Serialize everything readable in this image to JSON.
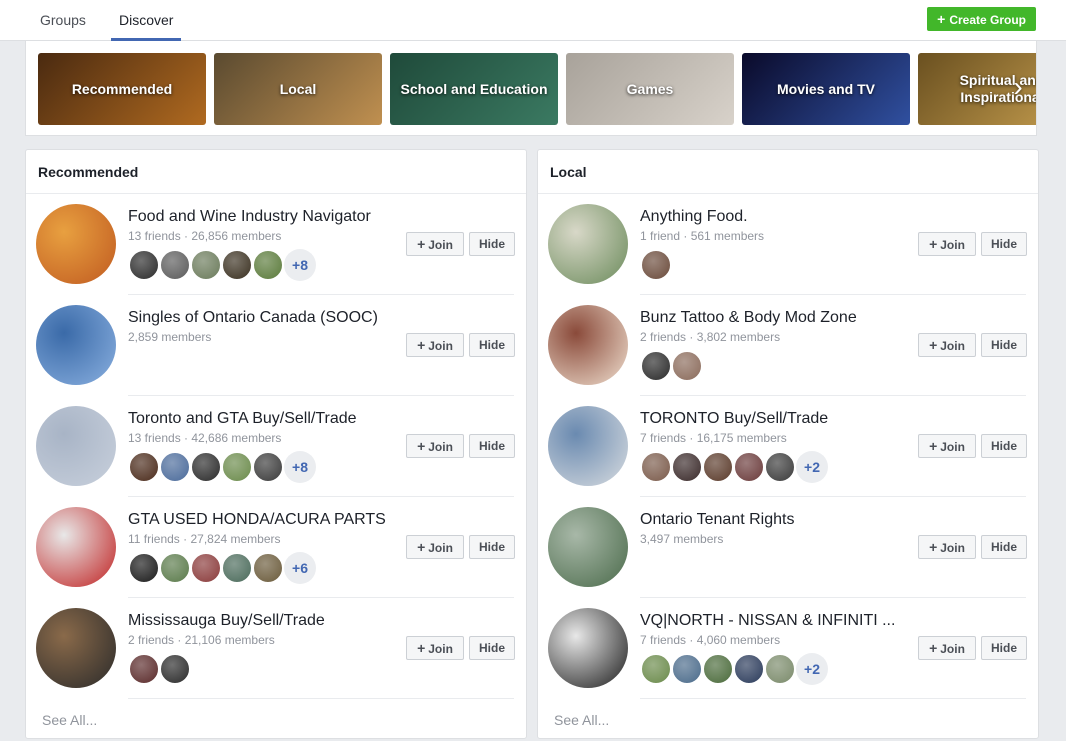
{
  "nav": {
    "tabs": [
      {
        "label": "Groups"
      },
      {
        "label": "Discover"
      }
    ],
    "create_button": "+ Create Group",
    "create_label": "Create Group",
    "create_plus": "+"
  },
  "categories": [
    {
      "label": "Recommended",
      "colors": [
        "#4a2a10",
        "#b06a20"
      ]
    },
    {
      "label": "Local",
      "colors": [
        "#5a4a30",
        "#c09050"
      ]
    },
    {
      "label": "School and Education",
      "colors": [
        "#1f4a3a",
        "#3b7a62"
      ]
    },
    {
      "label": "Games",
      "colors": [
        "#a8a29a",
        "#d8d2ca"
      ]
    },
    {
      "label": "Movies and TV",
      "colors": [
        "#0a0a2a",
        "#3050a0"
      ]
    },
    {
      "label": "Spiritual and Inspirational",
      "colors": [
        "#6a5020",
        "#c8a050"
      ]
    }
  ],
  "columns": [
    {
      "title": "Recommended",
      "see_all": "See All...",
      "groups": [
        {
          "name": "Food and Wine Industry Navigator",
          "meta": "13 friends · 26,856 members",
          "photo": [
            "#c05a20",
            "#e8a040"
          ],
          "faces": [
            "#2a2a2a",
            "#5a5a5a",
            "#6a7a5a",
            "#3a3020",
            "#5a7a3a"
          ],
          "more": "+8"
        },
        {
          "name": "Singles of Ontario Canada (SOOC)",
          "meta": "2,859 members",
          "photo": [
            "#8ab0e0",
            "#3a6aa8"
          ],
          "faces": [],
          "more": ""
        },
        {
          "name": "Toronto and GTA Buy/Sell/Trade",
          "meta": "13 friends · 42,686 members",
          "photo": [
            "#c8d0dc",
            "#a8b4c6"
          ],
          "faces": [
            "#4a2a1a",
            "#4a6a9a",
            "#2a2a2a",
            "#6a8a4a",
            "#3a3a3a"
          ],
          "more": "+8"
        },
        {
          "name": "GTA USED HONDA/ACURA PARTS",
          "meta": "11 friends · 27,824 members",
          "photo": [
            "#c02020",
            "#e8e8e8"
          ],
          "faces": [
            "#1a1a1a",
            "#5a7a4a",
            "#8a3a3a",
            "#4a6a5a",
            "#6a5a3a"
          ],
          "more": "+6"
        },
        {
          "name": "Mississauga Buy/Sell/Trade",
          "meta": "2 friends · 21,106 members",
          "photo": [
            "#2a2a2a",
            "#8a6a4a"
          ],
          "faces": [
            "#5a2a2a",
            "#2a2a2a"
          ],
          "more": ""
        }
      ]
    },
    {
      "title": "Local",
      "see_all": "See All...",
      "groups": [
        {
          "name": "Anything Food.",
          "meta": "1 friend · 561 members",
          "photo": [
            "#6a8a5a",
            "#d8d8c8"
          ],
          "faces": [
            "#6a4a3a"
          ],
          "more": ""
        },
        {
          "name": "Bunz Tattoo & Body Mod Zone",
          "meta": "2 friends · 3,802 members",
          "photo": [
            "#f0e0d0",
            "#8a4a3a"
          ],
          "faces": [
            "#2a2a2a",
            "#8a6a5a"
          ],
          "more": ""
        },
        {
          "name": "TORONTO Buy/Sell/Trade",
          "meta": "7 friends · 16,175 members",
          "photo": [
            "#d8dce0",
            "#6a8ab0"
          ],
          "faces": [
            "#7a5a4a",
            "#3a2a2a",
            "#5a3a2a",
            "#6a3a3a",
            "#3a3a3a"
          ],
          "more": "+2"
        },
        {
          "name": "Ontario Tenant Rights",
          "meta": "3,497 members",
          "photo": [
            "#4a6a4a",
            "#a8b8a8"
          ],
          "faces": [],
          "more": ""
        },
        {
          "name": "VQ|NORTH - NISSAN & INFINITI ...",
          "meta": "7 friends · 4,060 members",
          "photo": [
            "#1a1a1a",
            "#e8e8e8"
          ],
          "faces": [
            "#6a8a4a",
            "#4a6a8a",
            "#4a6a3a",
            "#2a3a5a",
            "#7a8a6a"
          ],
          "more": "+2"
        }
      ]
    }
  ],
  "buttons": {
    "join": "Join",
    "join_plus": "+",
    "hide": "Hide"
  }
}
